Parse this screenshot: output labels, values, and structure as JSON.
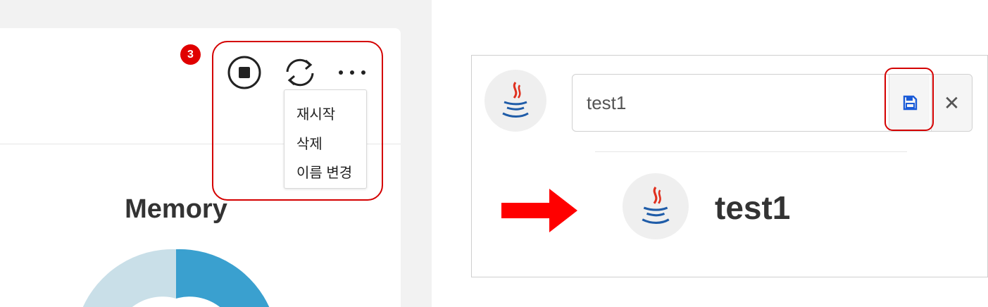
{
  "left_panel": {
    "step_badge": "3",
    "toolbar": {
      "stop_icon": "stop-circle-icon",
      "restart_icon": "refresh-icon",
      "more_icon": "more-horizontal-icon"
    },
    "menu": {
      "items": [
        {
          "label": "재시작"
        },
        {
          "label": "삭제"
        },
        {
          "label": "이름 변경"
        }
      ]
    },
    "memory_title": "Memory",
    "donut": {
      "colors": {
        "used": "#3aa0cf",
        "free": "#c9dfe8"
      }
    }
  },
  "right_panel": {
    "avatar_icon": "java-icon",
    "input": {
      "value": "test1"
    },
    "save_icon": "floppy-disk-icon",
    "close_label": "✕",
    "arrow_icon": "right-arrow-icon",
    "result_name": "test1"
  },
  "colors": {
    "highlight": "#d40000",
    "save_icon": "#1a5bd8",
    "arrow": "#ff0000"
  }
}
